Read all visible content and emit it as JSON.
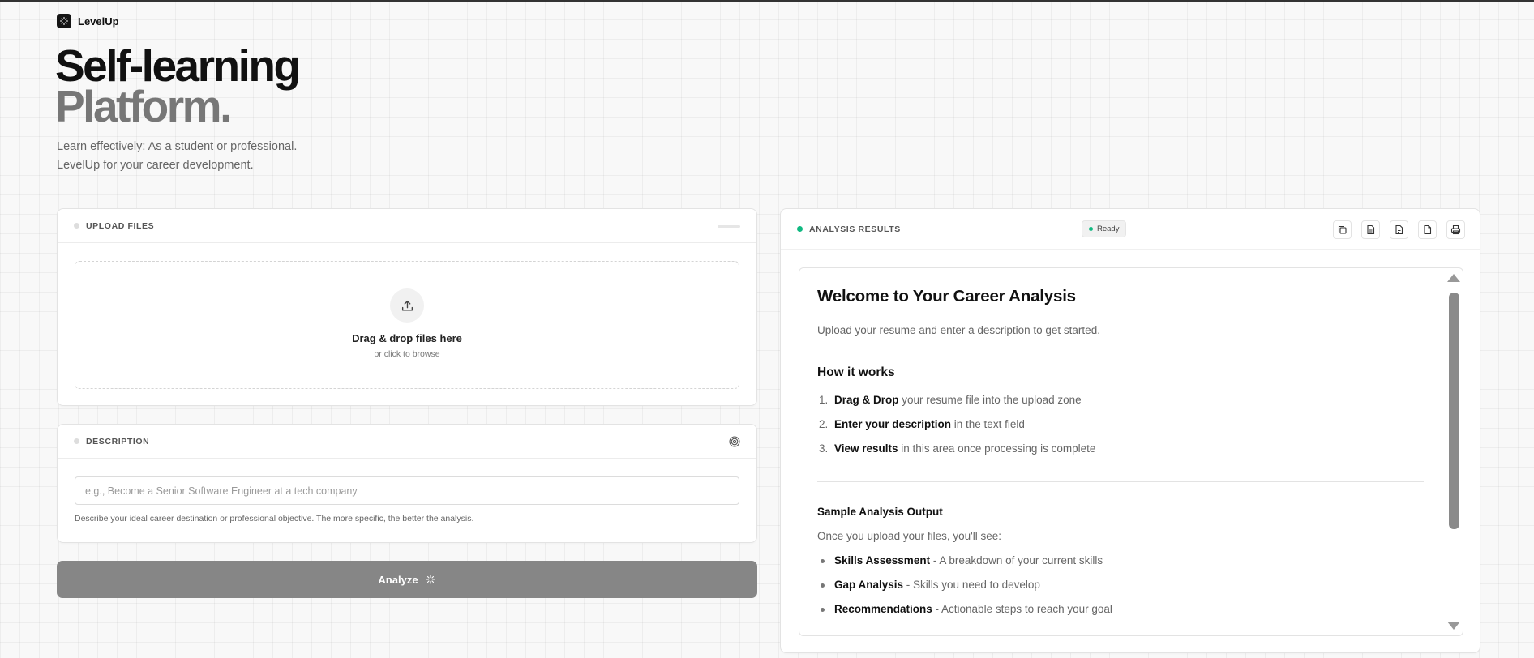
{
  "brand": {
    "name": "LevelUp",
    "logo_icon": "sparkle-icon"
  },
  "hero": {
    "line1": "Self-learning",
    "line2": "Platform.",
    "subtitle_line1": "Learn effectively: As a student or professional.",
    "subtitle_line2": "LevelUp for your career development."
  },
  "upload": {
    "title": "UPLOAD FILES",
    "drop_title": "Drag & drop files here",
    "drop_sub": "or click to browse",
    "icon": "upload-icon"
  },
  "description": {
    "title": "DESCRIPTION",
    "placeholder": "e.g., Become a Senior Software Engineer at a tech company",
    "value": "",
    "help": "Describe your ideal career destination or professional objective. The more specific, the better the analysis.",
    "icon": "target-icon"
  },
  "analyze": {
    "label": "Analyze",
    "icon": "sparkle-icon"
  },
  "results": {
    "title": "ANALYSIS RESULTS",
    "status": "Ready",
    "toolbar": [
      "copy-icon",
      "document-icon",
      "document-text-icon",
      "file-icon",
      "print-icon"
    ],
    "content": {
      "heading": "Welcome to Your Career Analysis",
      "intro": "Upload your resume and enter a description to get started.",
      "how_title": "How it works",
      "steps": [
        {
          "num": "1.",
          "bold": "Drag & Drop",
          "text": " your resume file into the upload zone"
        },
        {
          "num": "2.",
          "bold": "Enter your description",
          "text": " in the text field"
        },
        {
          "num": "3.",
          "bold": "View results",
          "text": " in this area once processing is complete"
        }
      ],
      "sample_title": "Sample Analysis Output",
      "sample_intro": "Once you upload your files, you'll see:",
      "bullets": [
        {
          "bold": "Skills Assessment",
          "text": " - A breakdown of your current skills"
        },
        {
          "bold": "Gap Analysis",
          "text": " - Skills you need to develop"
        },
        {
          "bold": "Recommendations",
          "text": " - Actionable steps to reach your goal"
        }
      ]
    }
  },
  "colors": {
    "accent_green": "#10b981",
    "analyze_button": "#868686",
    "text_dark": "#111111",
    "text_muted": "#666666"
  }
}
